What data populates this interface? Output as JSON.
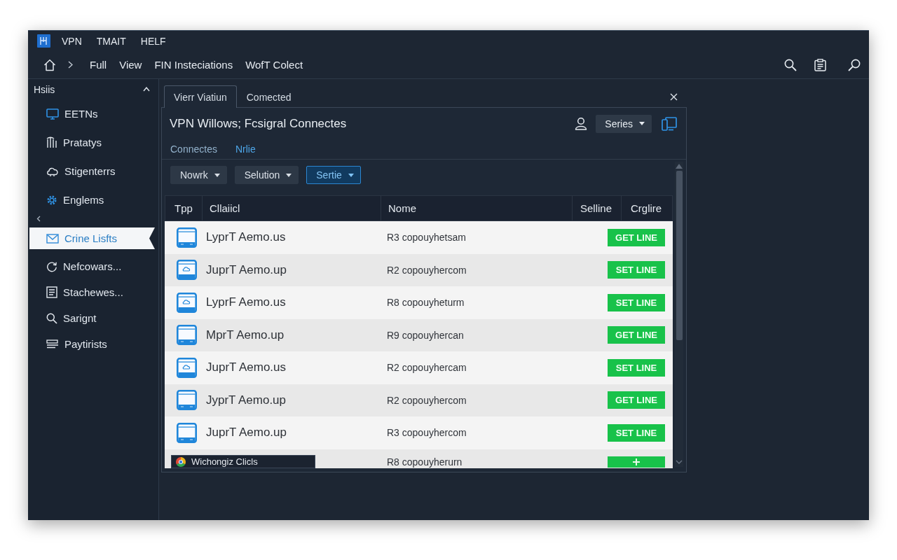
{
  "menu": [
    "VPN",
    "TMAIT",
    "HELF"
  ],
  "breadcrumb": [
    "Full",
    "View",
    "FIN Insteciations",
    "WofT Colect"
  ],
  "sidebar": {
    "title": "Hsiis",
    "expanded": true,
    "groups": [
      {
        "items": [
          {
            "label": "EETNs",
            "selected": false
          },
          {
            "label": "Pratatys",
            "selected": false
          },
          {
            "label": "Stigenterrs",
            "selected": false
          },
          {
            "label": "Englems",
            "selected": false
          }
        ]
      },
      {
        "items": [
          {
            "label": "Crine Lisfts",
            "selected": true
          },
          {
            "label": "Nefcowars...",
            "selected": false
          },
          {
            "label": "Stachewes...",
            "selected": false
          },
          {
            "label": "Sarignt",
            "selected": false
          },
          {
            "label": "Paytirists",
            "selected": false
          }
        ]
      }
    ]
  },
  "tabs": [
    {
      "label": "Vierr Viatiun",
      "selected": true
    },
    {
      "label": "Comected",
      "selected": false
    }
  ],
  "panel": {
    "title": "VPN Willows; Fcsigral Connectes",
    "dropdown": {
      "label": "Series"
    },
    "subtabs": [
      {
        "label": "Connectes",
        "selected": false
      },
      {
        "label": "Nrlie",
        "selected": true
      }
    ],
    "filters": [
      {
        "label": "Nowrk",
        "selected": false
      },
      {
        "label": "Selution",
        "selected": false
      },
      {
        "label": "Sertie",
        "selected": true
      }
    ],
    "table": {
      "columns": [
        "Tpp",
        "Cllaiicl",
        "Nome",
        "Selline",
        "Crglire"
      ],
      "rows": [
        {
          "kind": "plain",
          "name": "LyprT Aemo.us",
          "host": "R3 copouyhetsam",
          "action": {
            "kind": "label",
            "label": "GET LINE"
          }
        },
        {
          "kind": "cloud",
          "name": "JuprT Aemo.up",
          "host": "R2 copouyhercom",
          "action": {
            "kind": "label",
            "label": "SET LINE"
          }
        },
        {
          "kind": "cloud",
          "name": "LyprF Aemo.us",
          "host": "R8 copouyheturm",
          "action": {
            "kind": "label",
            "label": "SET LINE"
          }
        },
        {
          "kind": "plain",
          "name": "MprT Aemo.up",
          "host": "R9 copouyhercan",
          "action": {
            "kind": "label",
            "label": "GET LINE"
          }
        },
        {
          "kind": "cloud",
          "name": "JuprT Aemo.us",
          "host": "R2 copouyhercam",
          "action": {
            "kind": "label",
            "label": "SET LINE"
          }
        },
        {
          "kind": "plain",
          "name": "JyprT Aemo.up",
          "host": "R2 copouyhercom",
          "action": {
            "kind": "label",
            "label": "GET LINE"
          }
        },
        {
          "kind": "plain",
          "name": "JuprT Aemo.up",
          "host": "R3 copouyhercom",
          "action": {
            "kind": "label",
            "label": "SET LINE"
          }
        },
        {
          "host": "R8 copouyherurn",
          "action": {
            "kind": "add"
          }
        }
      ]
    },
    "tooltip": {
      "label": "Wichongiz Clicls"
    }
  }
}
